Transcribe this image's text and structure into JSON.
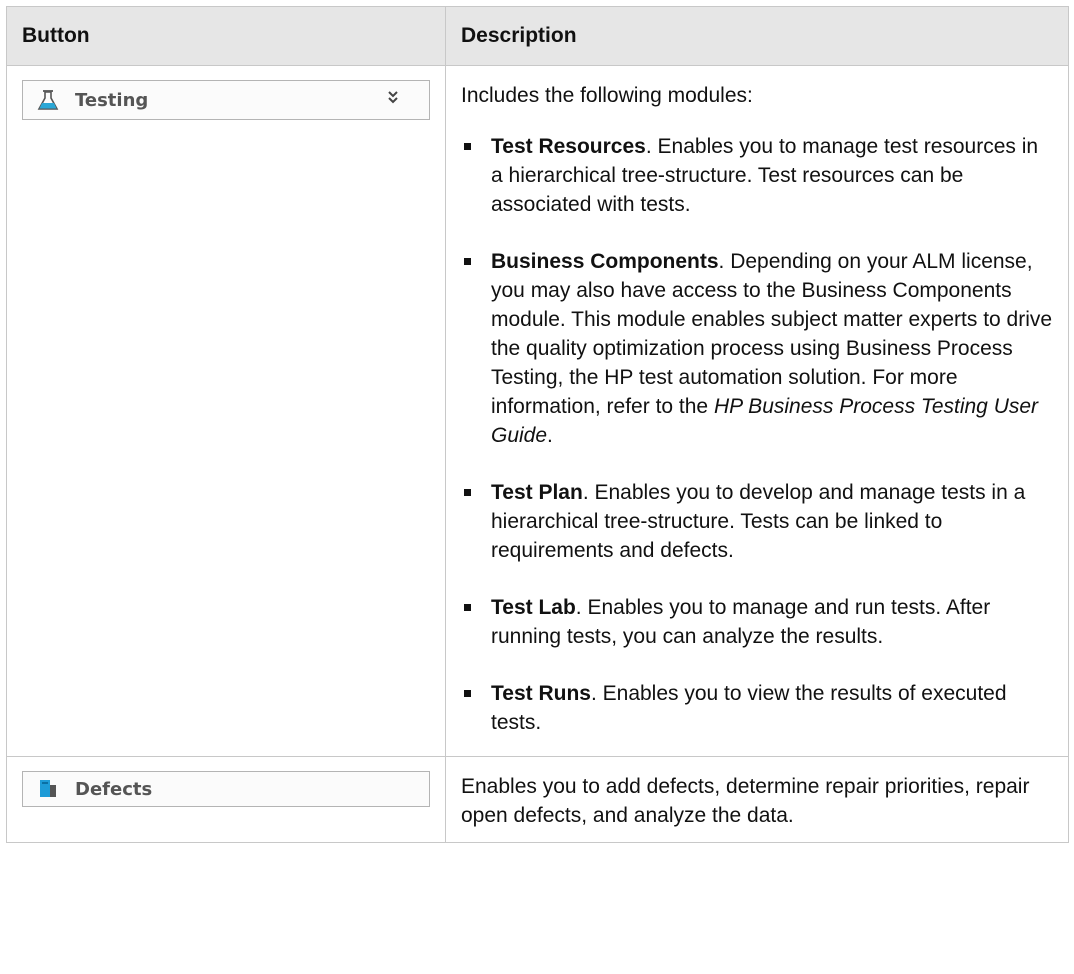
{
  "header": {
    "col_button": "Button",
    "col_description": "Description"
  },
  "rows": [
    {
      "button": {
        "label": "Testing",
        "icon": "flask-icon",
        "chevron": "double-chevron-down-icon"
      },
      "description": {
        "intro": "Includes the following modules:",
        "items": [
          {
            "title": "Test Resources",
            "text": ". Enables you to manage test resources in a hierarchical tree-structure. Test resources can be associated with tests."
          },
          {
            "title": "Business Components",
            "text": ". Depending on your ALM license, you may also have access to the Business Components module. This module enables subject matter experts to drive the quality optimization process using Business Process Testing, the HP test automation solution. For more information, refer to the ",
            "italic": "HP Business Process Testing User Guide",
            "tail": "."
          },
          {
            "title": "Test Plan",
            "text": ". Enables you to develop and manage tests in a hierarchical tree-structure. Tests can be linked to requirements and defects."
          },
          {
            "title": "Test Lab",
            "text": ". Enables you to manage and run tests. After running tests, you can analyze the results."
          },
          {
            "title": "Test Runs",
            "text": ". Enables you to view the results of executed tests."
          }
        ]
      }
    },
    {
      "button": {
        "label": "Defects",
        "icon": "defects-icon"
      },
      "description": {
        "text": "Enables you to add defects, determine repair priorities, repair open defects, and analyze the data."
      }
    }
  ],
  "colors": {
    "header_bg": "#e6e6e6",
    "border": "#c8c8c8",
    "flask_liquid": "#2aa7d6",
    "defects_blue": "#1e9bd7"
  }
}
